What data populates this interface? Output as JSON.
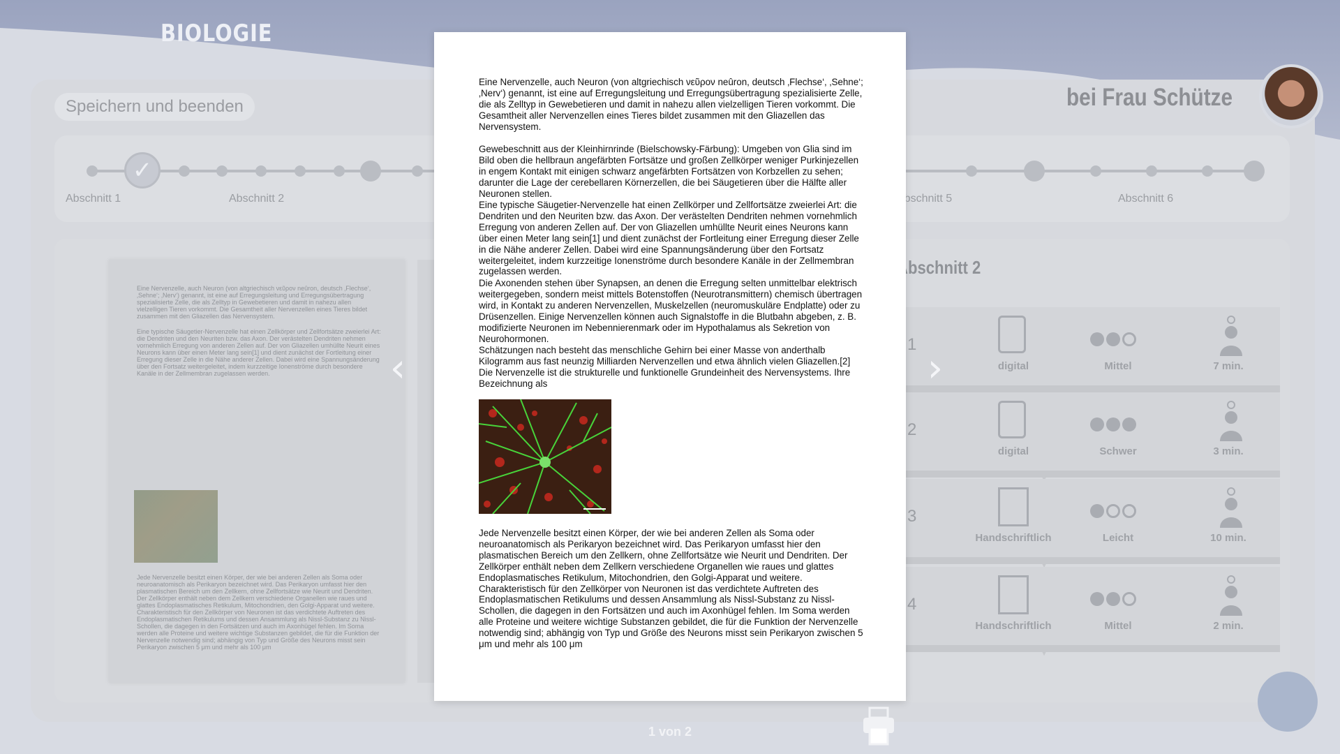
{
  "header": {
    "subject": "BIOLOGIE",
    "save_button": "Speichern und beenden",
    "teacher": "bei Frau Schütze"
  },
  "progress": {
    "sections": [
      "Abschnitt 1",
      "Abschnitt 2",
      "Abschnitt 5",
      "Abschnitt 6"
    ]
  },
  "content": {
    "section_title": "Abschnitt 2",
    "tasks": [
      {
        "num": "1",
        "type": "digital",
        "difficulty": "Mittel",
        "level": 2,
        "time": "7 min."
      },
      {
        "num": "2",
        "type": "digital",
        "difficulty": "Schwer",
        "level": 3,
        "time": "3 min."
      },
      {
        "num": "3",
        "type": "Handschriftlich",
        "difficulty": "Leicht",
        "level": 1,
        "time": "10 min."
      },
      {
        "num": "4",
        "type": "Handschriftlich",
        "difficulty": "Mittel",
        "level": 2,
        "time": "2 min."
      }
    ]
  },
  "document": {
    "p1": "Eine Nervenzelle, auch Neuron (von altgriechisch νεῦρον neûron, deutsch ‚Flechse‘, ‚Sehne‘; ‚Nerv‘) genannt, ist eine auf Erregungsleitung und Erregungsübertragung spezialisierte Zelle, die als Zelltyp in Gewebetieren und damit in nahezu allen vielzelligen Tieren vorkommt. Die Gesamtheit aller Nervenzellen eines Tieres bildet zusammen mit den Gliazellen das Nervensystem.",
    "p2": "Gewebeschnitt aus der Kleinhirnrinde (Bielschowsky-Färbung): Umgeben von Glia sind im Bild oben die hellbraun angefärbten Fortsätze und großen Zellkörper weniger Purkinjezellen in engem Kontakt mit einigen schwarz angefärbten Fortsätzen von Korbzellen zu sehen; darunter die Lage der cerebellaren Körnerzellen, die bei Säugetieren über die Hälfte aller Neuronen stellen.",
    "p3": "Eine typische Säugetier-Nervenzelle hat einen Zellkörper und Zellfortsätze zweierlei Art: die Dendriten und den Neuriten bzw. das Axon. Der verästelten Dendriten nehmen vornehmlich Erregung von anderen Zellen auf. Der von Gliazellen umhüllte Neurit eines Neurons kann über einen Meter lang sein[1] und dient zunächst der Fortleitung einer Erregung dieser Zelle in die Nähe anderer Zellen. Dabei wird eine Spannungsänderung über den Fortsatz weitergeleitet, indem kurzzeitige Ionenströme durch besondere Kanäle in der Zellmembran zugelassen werden.",
    "p4": "Die Axonenden stehen über Synapsen, an denen die Erregung selten unmittelbar elektrisch weitergegeben, sondern meist mittels Botenstoffen (Neurotransmittern) chemisch übertragen wird, in Kontakt zu anderen Nervenzellen, Muskelzellen (neuromuskuläre Endplatte) oder zu Drüsenzellen. Einige Nervenzellen können auch Signalstoffe in die Blutbahn abgeben, z. B. modifizierte Neuronen im Nebennierenmark oder im Hypothalamus als Sekretion von Neurohormonen.",
    "p5": "Schätzungen nach besteht das menschliche Gehirn bei einer Masse von anderthalb Kilogramm aus fast neunzig Milliarden Nervenzellen und etwa ähnlich vielen Gliazellen.[2]",
    "p6": "Die Nervenzelle ist die strukturelle und funktionelle Grundeinheit des Nervensystems. Ihre Bezeichnung als",
    "p7": "Jede Nervenzelle besitzt einen Körper, der wie bei anderen Zellen als Soma oder neuroanatomisch als Perikaryon bezeichnet wird. Das Perikaryon umfasst hier den plasmatischen Bereich um den Zellkern, ohne Zellfortsätze wie Neurit und Dendriten. Der Zellkörper enthält neben dem Zellkern verschiedene Organellen wie raues und glattes Endoplasmatisches Retikulum, Mitochondrien, den Golgi-Apparat und weitere. Charakteristisch für den Zellkörper von Neuronen ist das verdichtete Auftreten des Endoplasmatischen Retikulums und dessen Ansammlung als Nissl-Substanz zu Nissl-Schollen, die dagegen in den Fortsätzen und auch im Axonhügel fehlen. Im Soma werden alle Proteine und weitere wichtige Substanzen gebildet, die für die Funktion der Nervenzelle notwendig sind; abhängig von Typ und Größe des Neurons misst sein Perikaryon zwischen 5 μm und mehr als 100 μm"
  },
  "pager": {
    "indicator": "1 von 2"
  }
}
